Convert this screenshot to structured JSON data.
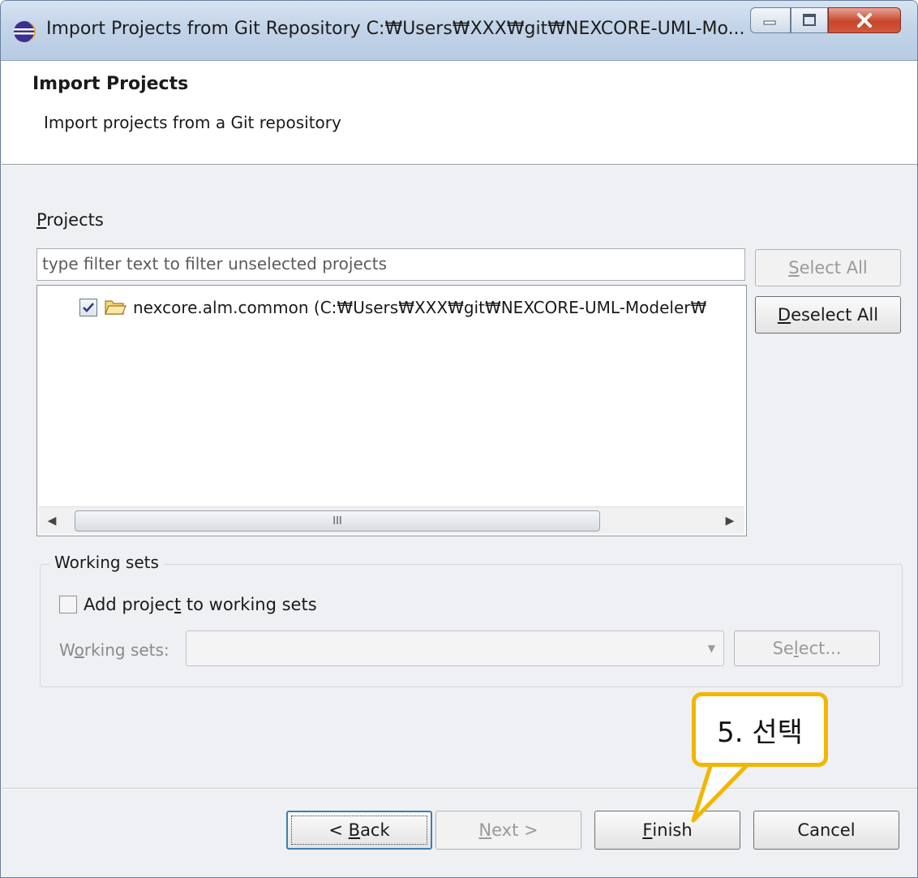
{
  "window": {
    "title": "Import Projects from Git Repository C:₩Users₩XXX₩git₩NEXCORE-UML-Mo..."
  },
  "header": {
    "title": "Import Projects",
    "subtitle": "Import projects from a Git repository"
  },
  "projects": {
    "label_first": "P",
    "label_rest": "rojects",
    "filter_placeholder": "type filter text to filter unselected projects",
    "items": [
      {
        "label": "nexcore.alm.common (C:₩Users₩XXX₩git₩NEXCORE-UML-Modeler₩",
        "checked": true
      }
    ],
    "select_all": {
      "mnemonic": "S",
      "rest": "elect All"
    },
    "deselect_all": {
      "mnemonic": "D",
      "rest": "eselect All"
    },
    "scroll_thumb_grip": "III"
  },
  "working_sets": {
    "legend": "Working sets",
    "add_label_pre": "Add projec",
    "add_label_mnemonic": "t",
    "add_label_post": " to working sets",
    "ws_label_pre": "W",
    "ws_label_mnemonic": "o",
    "ws_label_post": "rking sets:",
    "select_pre": "Se",
    "select_mnemonic": "l",
    "select_post": "ect..."
  },
  "buttons": {
    "back_pre": "< ",
    "back_mnemonic": "B",
    "back_post": "ack",
    "next_mnemonic": "N",
    "next_post": "ext >",
    "finish_mnemonic": "F",
    "finish_post": "inish",
    "cancel": "Cancel"
  },
  "callout": {
    "text": "5. 선택",
    "color": "#f2b600"
  },
  "colors": {
    "titlebar": "#c3d4e8",
    "close_button": "#c7452b",
    "dialog_bg": "#eef0f3"
  }
}
